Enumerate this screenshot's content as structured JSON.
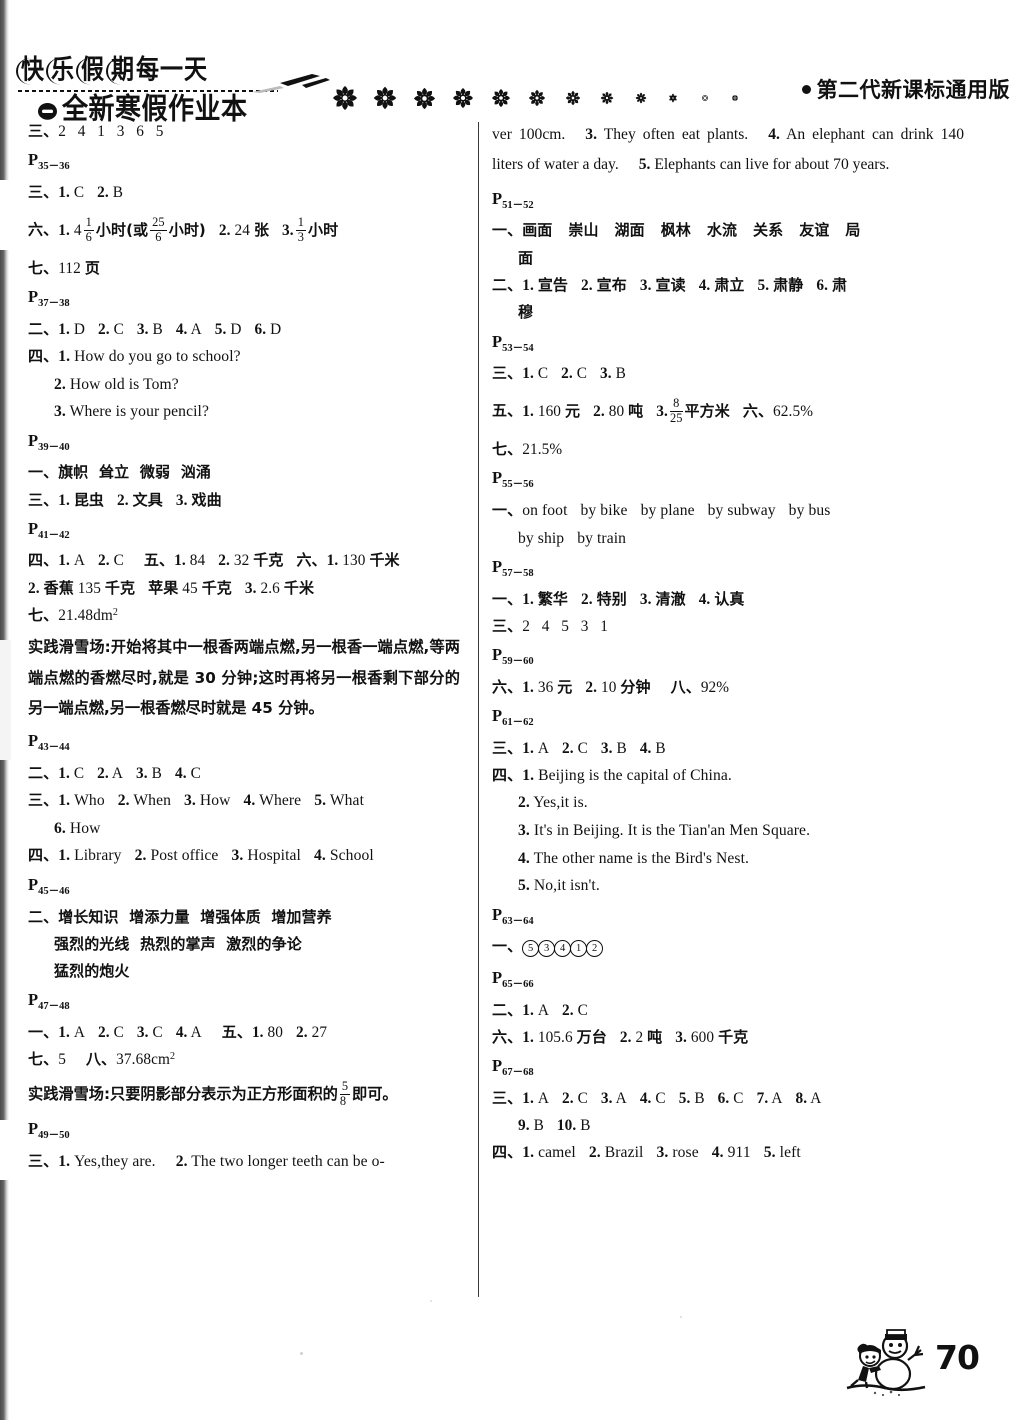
{
  "header": {
    "brand_line1": "快乐假期 每一天",
    "brand_line1_chars": [
      "快",
      "乐",
      "假",
      "期"
    ],
    "brand_line1_tail": "每一天",
    "brand_line2": "全新寒假作业本",
    "edition": "第二代新课标通用版",
    "snowflake_icon": "snowflake-icon",
    "snowflake_count": 12
  },
  "columns": {
    "left": [
      {
        "id": "l1",
        "type": "answer",
        "label": "三、",
        "text": "2    4    1    3    6    5"
      },
      {
        "id": "l2",
        "type": "pagemark",
        "letter": "P",
        "range": "35－36"
      },
      {
        "id": "l3",
        "type": "answer",
        "label": "三、",
        "text": "1. C   2. B"
      },
      {
        "id": "l4",
        "type": "answer-frac",
        "label": "六、",
        "text": "1. 4 1/6 小时(或 25/6 小时)   2. 24 张   3. 1/3 小时"
      },
      {
        "id": "l5",
        "type": "answer",
        "label": "七、",
        "text": "112 页"
      },
      {
        "id": "l6",
        "type": "pagemark",
        "letter": "P",
        "range": "37－38"
      },
      {
        "id": "l7",
        "type": "answer",
        "label": "二、",
        "text": "1. D   2. C   3. B   4. A   5. D   6. D"
      },
      {
        "id": "l8",
        "type": "answer",
        "label": "四、",
        "text": "1. How do you go to school?"
      },
      {
        "id": "l9",
        "type": "answer-indent",
        "label": "",
        "text": "2. How old is Tom?"
      },
      {
        "id": "l10",
        "type": "answer-indent",
        "label": "",
        "text": "3. Where is your pencil?"
      },
      {
        "id": "l11",
        "type": "pagemark",
        "letter": "P",
        "range": "39－40"
      },
      {
        "id": "l12",
        "type": "answer",
        "label": "一、",
        "text": "旗帜   耸立   微弱   汹涌"
      },
      {
        "id": "l13",
        "type": "answer",
        "label": "三、",
        "text": "1. 昆虫   2. 文具   3. 戏曲"
      },
      {
        "id": "l14",
        "type": "pagemark",
        "letter": "P",
        "range": "41－42"
      },
      {
        "id": "l15",
        "type": "answer",
        "label": "四、",
        "text": "1. A   2. C    五、1. 84   2. 32 千克   六、1. 130 千米"
      },
      {
        "id": "l16",
        "type": "answer",
        "label": "",
        "text": "2. 香蕉 135 千克   苹果 45 千克   3. 2.6 千米"
      },
      {
        "id": "l17",
        "type": "answer",
        "label": "七、",
        "text": "21.48dm²"
      },
      {
        "id": "l18",
        "type": "paragraph-cn",
        "text": "实践滑雪场:开始将其中一根香两端点燃,另一根香一端点燃,等两端点燃的香燃尽时,就是 30 分钟;这时再将另一根香剩下部分的另一端点燃,另一根香燃尽时就是 45 分钟。"
      },
      {
        "id": "l19",
        "type": "pagemark",
        "letter": "P",
        "range": "43－44"
      },
      {
        "id": "l20",
        "type": "answer",
        "label": "二、",
        "text": "1. C   2. A   3. B   4. C"
      },
      {
        "id": "l21",
        "type": "answer",
        "label": "三、",
        "text": "1. Who   2. When   3. How   4. Where   5. What"
      },
      {
        "id": "l22",
        "type": "answer-indent",
        "label": "",
        "text": "6. How"
      },
      {
        "id": "l23",
        "type": "answer",
        "label": "四、",
        "text": "1. Library   2. Post office   3. Hospital   4. School"
      },
      {
        "id": "l24",
        "type": "pagemark",
        "letter": "P",
        "range": "45－46"
      },
      {
        "id": "l25",
        "type": "answer",
        "label": "二、",
        "text": "增长知识   增添力量   增强体质   增加营养"
      },
      {
        "id": "l26",
        "type": "answer-indent",
        "label": "",
        "text": "强烈的光线   热烈的掌声   激烈的争论"
      },
      {
        "id": "l27",
        "type": "answer-indent",
        "label": "",
        "text": "猛烈的炮火"
      },
      {
        "id": "l28",
        "type": "pagemark",
        "letter": "P",
        "range": "47－48"
      },
      {
        "id": "l29",
        "type": "answer",
        "label": "一、",
        "text": "1. A   2. C   3. C   4. A    五、1. 80   2. 27"
      },
      {
        "id": "l30",
        "type": "answer",
        "label": "七、",
        "text": "5    八、37.68cm²"
      },
      {
        "id": "l31",
        "type": "paragraph-cn-frac",
        "text": "实践滑雪场:只要阴影部分表示为正方形面积的 5/8 即可。"
      },
      {
        "id": "l32",
        "type": "pagemark",
        "letter": "P",
        "range": "49－50"
      },
      {
        "id": "l33",
        "type": "answer",
        "label": "三、",
        "text": "1. Yes,they are.    2. The two longer teeth can be o-"
      }
    ],
    "right": [
      {
        "id": "r1",
        "type": "paragraph-en",
        "text": "ver 100cm.    3. They often eat plants.    4. An elephant can drink 140 liters of water a day.    5. Elephants can live for about 70 years."
      },
      {
        "id": "r2",
        "type": "pagemark",
        "letter": "P",
        "range": "51－52"
      },
      {
        "id": "r3",
        "type": "answer",
        "label": "一、",
        "text": "画面   崇山   湖面   枫林   水流   关系   友谊   局"
      },
      {
        "id": "r4",
        "type": "answer-indent",
        "label": "",
        "text": "面"
      },
      {
        "id": "r5",
        "type": "answer",
        "label": "二、",
        "text": "1. 宣告   2. 宣布   3. 宣读   4. 肃立   5. 肃静   6. 肃"
      },
      {
        "id": "r6",
        "type": "answer-indent",
        "label": "",
        "text": "穆"
      },
      {
        "id": "r7",
        "type": "pagemark",
        "letter": "P",
        "range": "53－54"
      },
      {
        "id": "r8",
        "type": "answer",
        "label": "三、",
        "text": "1. C   2. C   3. B"
      },
      {
        "id": "r9",
        "type": "answer-frac2",
        "label": "五、",
        "text": "1. 160 元   2. 80 吨   3. 8/25 平方米   六、62.5%"
      },
      {
        "id": "r10",
        "type": "answer",
        "label": "七、",
        "text": "21.5%"
      },
      {
        "id": "r11",
        "type": "pagemark",
        "letter": "P",
        "range": "55－56"
      },
      {
        "id": "r12",
        "type": "answer",
        "label": "一、",
        "text": "on foot   by bike   by plane   by subway   by bus"
      },
      {
        "id": "r13",
        "type": "answer-indent",
        "label": "",
        "text": "by ship   by train"
      },
      {
        "id": "r14",
        "type": "pagemark",
        "letter": "P",
        "range": "57－58"
      },
      {
        "id": "r15",
        "type": "answer",
        "label": "一、",
        "text": "1. 繁华   2. 特别   3. 清澈   4. 认真"
      },
      {
        "id": "r16",
        "type": "answer",
        "label": "三、",
        "text": "2   4   5   3   1"
      },
      {
        "id": "r17",
        "type": "pagemark",
        "letter": "P",
        "range": "59－60"
      },
      {
        "id": "r18",
        "type": "answer",
        "label": "六、",
        "text": "1. 36 元   2. 10 分钟    八、92%"
      },
      {
        "id": "r19",
        "type": "pagemark",
        "letter": "P",
        "range": "61－62"
      },
      {
        "id": "r20",
        "type": "answer",
        "label": "三、",
        "text": "1. A   2. C   3. B   4. B"
      },
      {
        "id": "r21",
        "type": "answer",
        "label": "四、",
        "text": "1. Beijing is the capital of China."
      },
      {
        "id": "r22",
        "type": "answer-indent",
        "label": "",
        "text": "2. Yes,it is."
      },
      {
        "id": "r23",
        "type": "answer-indent",
        "label": "",
        "text": "3. It's in Beijing. It is the Tian'an Men Square."
      },
      {
        "id": "r24",
        "type": "answer-indent",
        "label": "",
        "text": "4. The other name is the Bird's Nest."
      },
      {
        "id": "r25",
        "type": "answer-indent",
        "label": "",
        "text": "5. No,it isn't."
      },
      {
        "id": "r26",
        "type": "pagemark",
        "letter": "P",
        "range": "63－64"
      },
      {
        "id": "r27",
        "type": "answer-circled",
        "label": "一、",
        "text": "⑤③④①②",
        "circled": [
          "5",
          "3",
          "4",
          "1",
          "2"
        ]
      },
      {
        "id": "r28",
        "type": "pagemark",
        "letter": "P",
        "range": "65－66"
      },
      {
        "id": "r29",
        "type": "answer",
        "label": "二、",
        "text": "1. A   2. C"
      },
      {
        "id": "r30",
        "type": "answer",
        "label": "六、",
        "text": "1. 105.6 万台   2. 2 吨   3. 600 千克"
      },
      {
        "id": "r31",
        "type": "pagemark",
        "letter": "P",
        "range": "67－68"
      },
      {
        "id": "r32",
        "type": "answer",
        "label": "三、",
        "text": "1. A   2. C   3. A   4. C   5. B   6. C   7. A   8. A"
      },
      {
        "id": "r33",
        "type": "answer-indent",
        "label": "",
        "text": "9. B   10. B"
      },
      {
        "id": "r34",
        "type": "answer",
        "label": "四、",
        "text": "1. camel   2. Brazil   3. rose   4. 911   5. left"
      }
    ]
  },
  "footer": {
    "page_number": "70",
    "snowman_icon": "snowman-icon"
  }
}
